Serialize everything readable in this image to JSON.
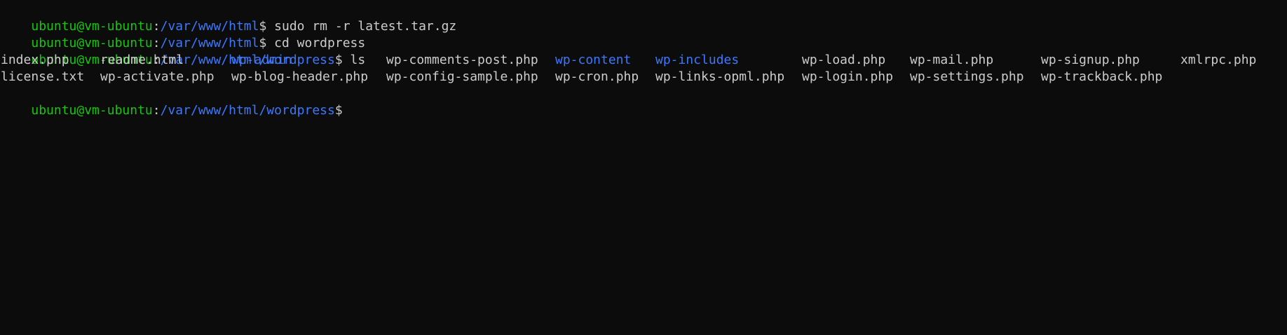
{
  "colors": {
    "background": "#0c0c0c",
    "text": "#cccccc",
    "user_host": "#16c60c",
    "path": "#3b78ff",
    "directory": "#3b78ff"
  },
  "history": [
    {
      "user_host": "ubuntu@vm-ubuntu",
      "sep": ":",
      "path": "/var/www/html",
      "prompt_symbol": "$",
      "command": " sudo rm -r latest.tar.gz"
    },
    {
      "user_host": "ubuntu@vm-ubuntu",
      "sep": ":",
      "path": "/var/www/html",
      "prompt_symbol": "$",
      "command": " cd wordpress"
    },
    {
      "user_host": "ubuntu@vm-ubuntu",
      "sep": ":",
      "path": "/var/www/html/wordpress",
      "prompt_symbol": "$",
      "command": " ls"
    }
  ],
  "ls_output": {
    "row1": [
      {
        "name": "index.php",
        "type": "file"
      },
      {
        "name": "readme.html",
        "type": "file"
      },
      {
        "name": "wp-admin",
        "type": "dir"
      },
      {
        "name": "wp-comments-post.php",
        "type": "file"
      },
      {
        "name": "wp-content",
        "type": "dir"
      },
      {
        "name": "wp-includes",
        "type": "dir"
      },
      {
        "name": "wp-load.php",
        "type": "file"
      },
      {
        "name": "wp-mail.php",
        "type": "file"
      },
      {
        "name": "wp-signup.php",
        "type": "file"
      },
      {
        "name": "xmlrpc.php",
        "type": "file"
      }
    ],
    "row2": [
      {
        "name": "license.txt",
        "type": "file"
      },
      {
        "name": "wp-activate.php",
        "type": "file"
      },
      {
        "name": "wp-blog-header.php",
        "type": "file"
      },
      {
        "name": "wp-config-sample.php",
        "type": "file"
      },
      {
        "name": "wp-cron.php",
        "type": "file"
      },
      {
        "name": "wp-links-opml.php",
        "type": "file"
      },
      {
        "name": "wp-login.php",
        "type": "file"
      },
      {
        "name": "wp-settings.php",
        "type": "file"
      },
      {
        "name": "wp-trackback.php",
        "type": "file"
      }
    ]
  },
  "current_prompt": {
    "user_host": "ubuntu@vm-ubuntu",
    "sep": ":",
    "path": "/var/www/html/wordpress",
    "prompt_symbol": "$"
  }
}
